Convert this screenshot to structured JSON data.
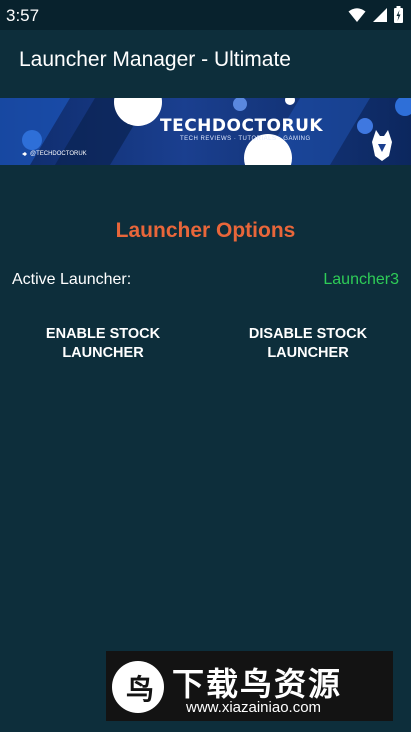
{
  "status_bar": {
    "time": "3:57",
    "icons": [
      "wifi-icon",
      "signal-icon",
      "battery-icon"
    ]
  },
  "app_bar": {
    "title": "Launcher Manager - Ultimate"
  },
  "banner": {
    "brand": "TECHDOCTORUK",
    "tagline": "TECH REVIEWS · TUTORIALS · GAMING",
    "handle": "@TECHDOCTORUK"
  },
  "main": {
    "section_title": "Launcher Options",
    "active_label": "Active Launcher:",
    "active_value": "Launcher3",
    "enable_button": "ENABLE STOCK\nLAUNCHER",
    "disable_button": "DISABLE STOCK\nLAUNCHER"
  },
  "watermark": {
    "title": "下载鸟资源",
    "url": "www.xiazainiao.com"
  },
  "colors": {
    "background": "#0d2e3b",
    "status_bar": "#08222d",
    "section_title": "#e8663a",
    "active_value": "#2ecc57"
  }
}
